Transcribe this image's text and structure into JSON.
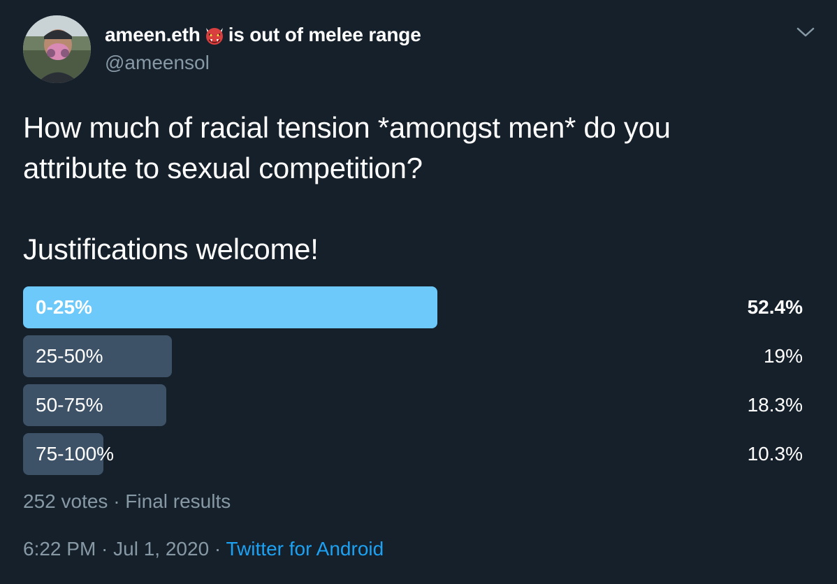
{
  "author": {
    "display_name": "ameen.eth",
    "display_suffix": "is out of melee range",
    "name_emoji": "ogre-emoji",
    "handle": "@ameensol"
  },
  "tweet": {
    "text_line1": "How much of racial tension *amongst men* do you",
    "text_line2": "attribute to sexual competition?",
    "text_line3": "Justifications welcome!"
  },
  "poll": {
    "options": [
      {
        "label": "0-25%",
        "percent_text": "52.4%",
        "percent": 52.4,
        "winner": true
      },
      {
        "label": "25-50%",
        "percent_text": "19%",
        "percent": 19,
        "winner": false
      },
      {
        "label": "50-75%",
        "percent_text": "18.3%",
        "percent": 18.3,
        "winner": false
      },
      {
        "label": "75-100%",
        "percent_text": "10.3%",
        "percent": 10.3,
        "winner": false
      }
    ],
    "votes_text": "252 votes · Final results"
  },
  "meta": {
    "time": "6:22 PM · Jul 1, 2020 · ",
    "source": "Twitter for Android"
  },
  "colors": {
    "background": "#15202b",
    "winner_bar": "#6cc9f9",
    "other_bar": "#3d5266",
    "muted_text": "#8899a6",
    "link": "#1da1f2"
  },
  "icons": {
    "caret": "chevron-down-icon"
  }
}
